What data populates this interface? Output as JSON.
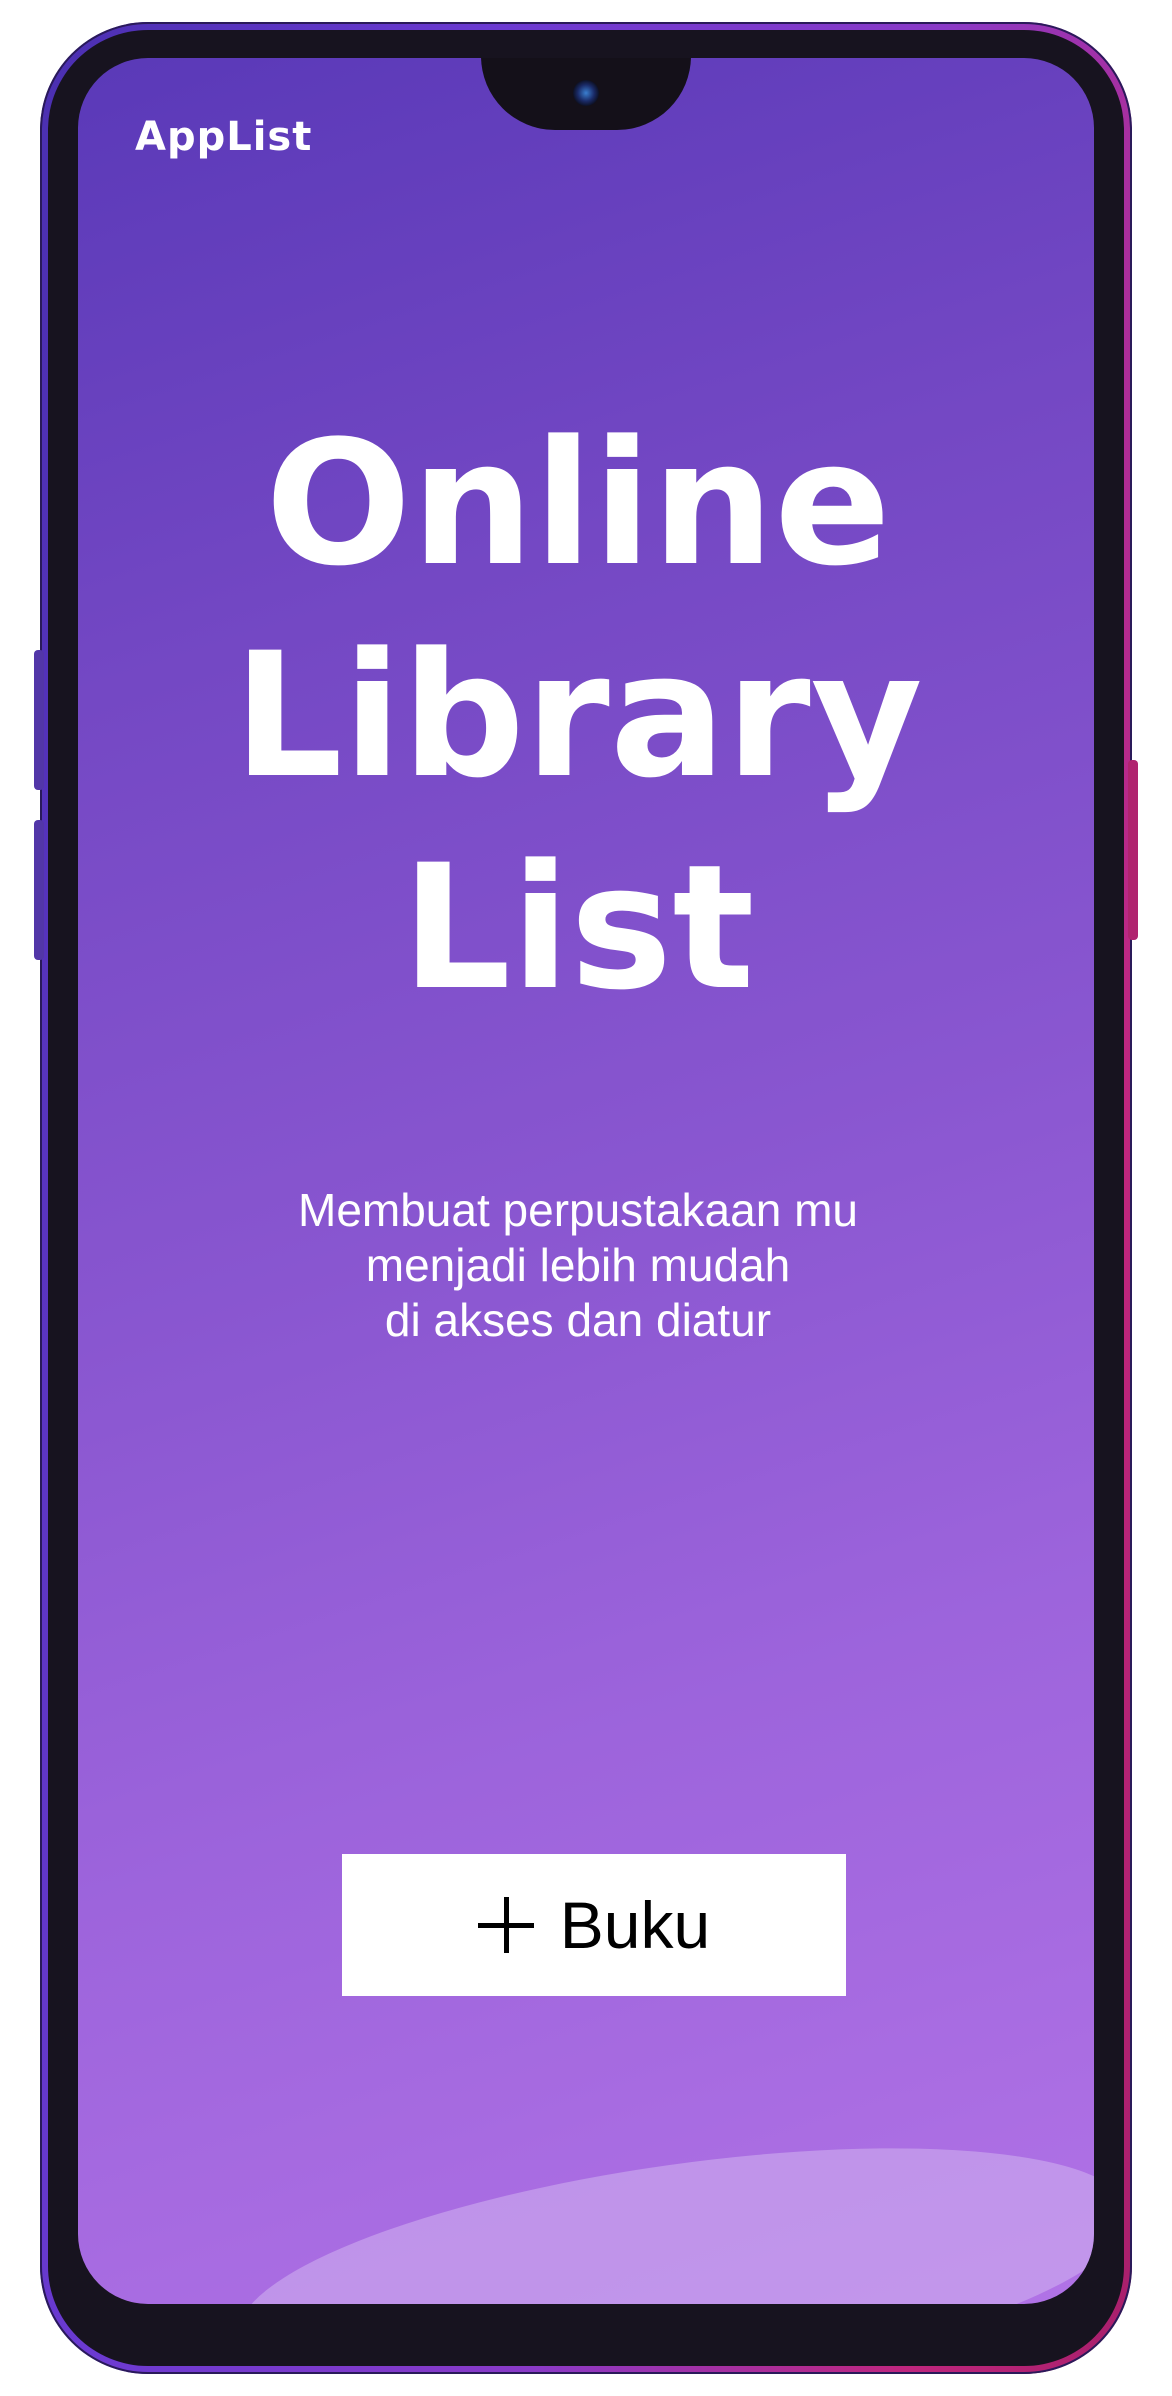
{
  "app": {
    "title": "AppList"
  },
  "hero": {
    "title_lines": [
      "Online",
      "Library",
      "List"
    ],
    "subtitle_lines": [
      "Membuat perpustakaan mu",
      "menjadi lebih mudah",
      "di akses dan diatur"
    ]
  },
  "actions": {
    "add_book_label": "Buku",
    "add_book_icon": "plus-icon"
  },
  "colors": {
    "background_start": "#5a39b8",
    "background_end": "#b172e6",
    "text": "#ffffff",
    "button_bg": "#ffffff",
    "button_text": "#000000"
  }
}
